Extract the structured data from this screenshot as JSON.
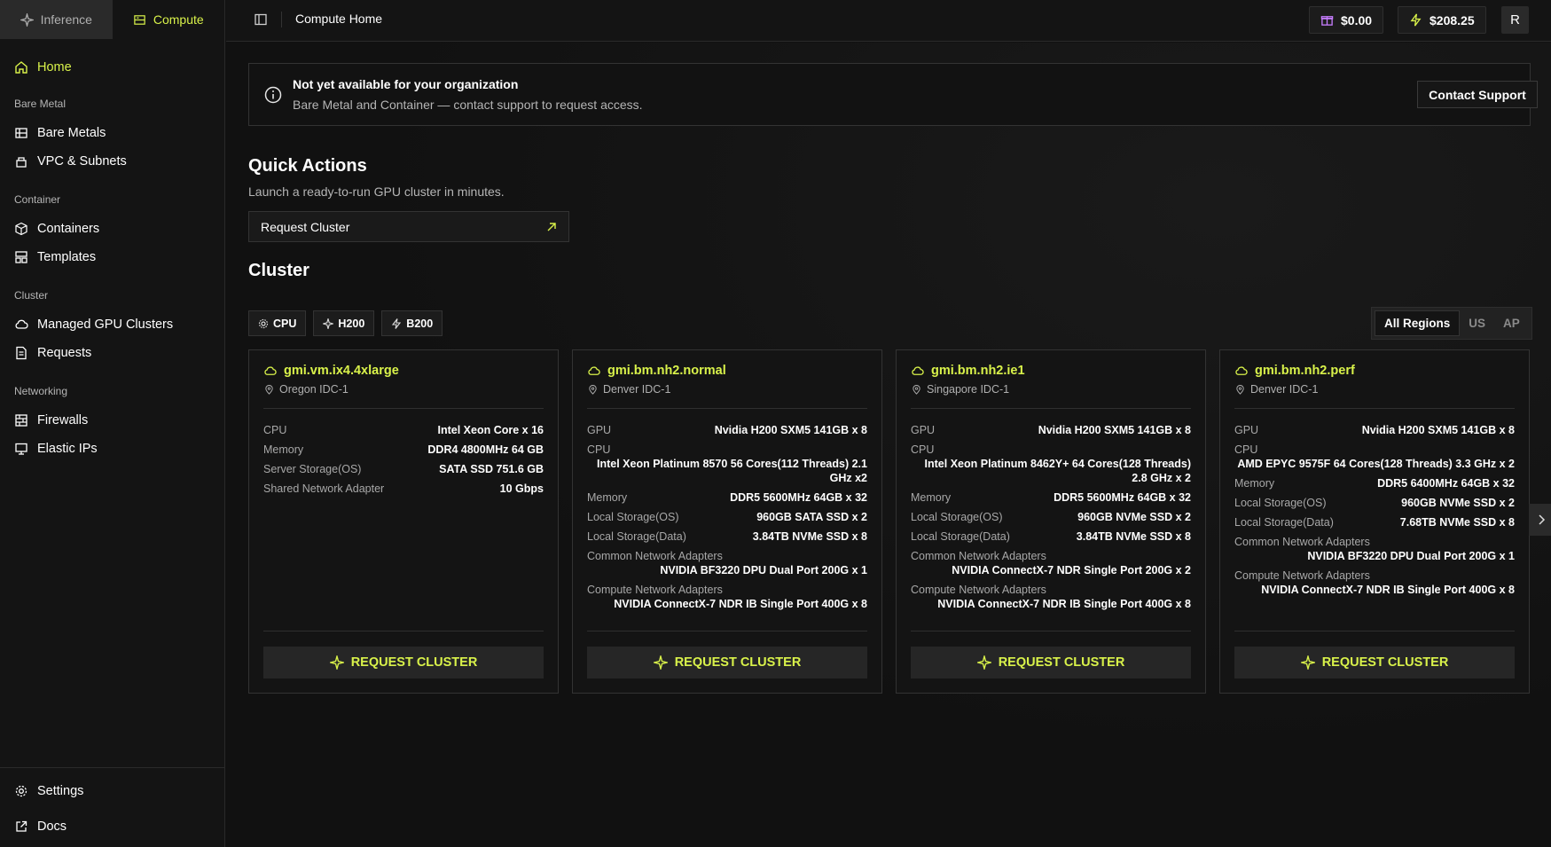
{
  "sidebar": {
    "switch": {
      "inference": "Inference",
      "compute": "Compute"
    },
    "home": "Home",
    "sections": [
      {
        "title": "Bare Metal",
        "items": [
          "Bare Metals",
          "VPC & Subnets"
        ]
      },
      {
        "title": "Container",
        "items": [
          "Containers",
          "Templates"
        ]
      },
      {
        "title": "Cluster",
        "items": [
          "Managed GPU Clusters",
          "Requests"
        ]
      },
      {
        "title": "Networking",
        "items": [
          "Firewalls",
          "Elastic IPs"
        ]
      }
    ],
    "bottom": {
      "settings": "Settings",
      "docs": "Docs"
    }
  },
  "header": {
    "title": "Compute Home",
    "credit": "$0.00",
    "balance": "$208.25",
    "avatar": "R"
  },
  "notice": {
    "title": "Not yet available for your organization",
    "body": "Bare Metal and Container — contact support to request access.",
    "button": "Contact Support"
  },
  "quick_actions": {
    "title": "Quick Actions",
    "subtitle": "Launch a ready-to-run GPU cluster in minutes.",
    "button": "Request Cluster"
  },
  "cluster": {
    "title": "Cluster",
    "filters": [
      "CPU",
      "H200",
      "B200"
    ],
    "regions": [
      "All Regions",
      "US",
      "AP"
    ],
    "cta": "REQUEST CLUSTER",
    "cards": [
      {
        "name": "gmi.vm.ix4.4xlarge",
        "location": "Oregon IDC-1",
        "rows": [
          {
            "k": "CPU",
            "v": "Intel Xeon Core x 16"
          },
          {
            "k": "Memory",
            "v": "DDR4 4800MHz 64 GB"
          },
          {
            "k": "Server Storage(OS)",
            "v": "SATA SSD 751.6 GB"
          },
          {
            "k": "Shared Network Adapter",
            "v": "10 Gbps"
          }
        ],
        "blocks": []
      },
      {
        "name": "gmi.bm.nh2.normal",
        "location": "Denver IDC-1",
        "rows": [
          {
            "k": "GPU",
            "v": "Nvidia H200 SXM5 141GB x 8"
          }
        ],
        "cpu": {
          "k": "CPU",
          "v": "Intel Xeon Platinum 8570 56 Cores(112 Threads) 2.1 GHz x2"
        },
        "rows2": [
          {
            "k": "Memory",
            "v": "DDR5 5600MHz 64GB x 32"
          },
          {
            "k": "Local Storage(OS)",
            "v": "960GB SATA SSD x 2"
          },
          {
            "k": "Local Storage(Data)",
            "v": "3.84TB NVMe SSD x 8"
          }
        ],
        "blocks": [
          {
            "k": "Common Network Adapters",
            "v": "NVIDIA BF3220 DPU Dual Port 200G x 1"
          },
          {
            "k": "Compute Network Adapters",
            "v": "NVIDIA ConnectX-7 NDR IB Single Port 400G x 8"
          }
        ]
      },
      {
        "name": "gmi.bm.nh2.ie1",
        "location": "Singapore IDC-1",
        "rows": [
          {
            "k": "GPU",
            "v": "Nvidia H200 SXM5 141GB x 8"
          }
        ],
        "cpu": {
          "k": "CPU",
          "v": "Intel Xeon Platinum 8462Y+ 64 Cores(128 Threads) 2.8 GHz x 2"
        },
        "rows2": [
          {
            "k": "Memory",
            "v": "DDR5 5600MHz 64GB x 32"
          },
          {
            "k": "Local Storage(OS)",
            "v": "960GB NVMe SSD x 2"
          },
          {
            "k": "Local Storage(Data)",
            "v": "3.84TB NVMe SSD x 8"
          }
        ],
        "blocks": [
          {
            "k": "Common Network Adapters",
            "v": "NVIDIA ConnectX-7 NDR Single Port 200G x 2"
          },
          {
            "k": "Compute Network Adapters",
            "v": "NVIDIA ConnectX-7 NDR IB Single Port 400G x 8"
          }
        ]
      },
      {
        "name": "gmi.bm.nh2.perf",
        "location": "Denver IDC-1",
        "rows": [
          {
            "k": "GPU",
            "v": "Nvidia H200 SXM5 141GB x 8"
          }
        ],
        "cpu": {
          "k": "CPU",
          "v": "AMD EPYC 9575F 64 Cores(128 Threads) 3.3 GHz x 2"
        },
        "rows2": [
          {
            "k": "Memory",
            "v": "DDR5 6400MHz 64GB x 32"
          },
          {
            "k": "Local Storage(OS)",
            "v": "960GB NVMe SSD x 2"
          },
          {
            "k": "Local Storage(Data)",
            "v": "7.68TB NVMe SSD x 8"
          }
        ],
        "blocks": [
          {
            "k": "Common Network Adapters",
            "v": "NVIDIA BF3220 DPU Dual Port 200G x 1"
          },
          {
            "k": "Compute Network Adapters",
            "v": "NVIDIA ConnectX-7 NDR IB Single Port 400G x 8"
          }
        ]
      }
    ]
  },
  "colors": {
    "accent": "#d9f24a",
    "background": "#111111",
    "panel": "#141414"
  }
}
